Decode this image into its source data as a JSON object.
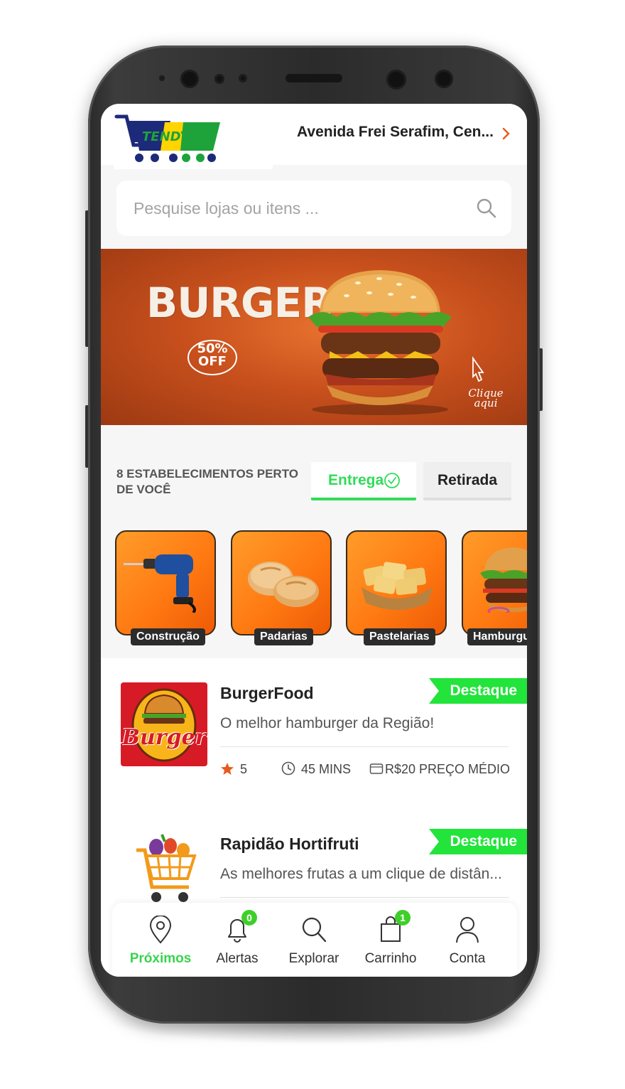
{
  "header": {
    "logo_text": "TENDYAAZ",
    "address": "Avenida Frei Serafim, Cen..."
  },
  "search": {
    "placeholder": "Pesquise lojas ou itens ..."
  },
  "banner": {
    "title": "BURGER",
    "discount_line1": "50%",
    "discount_line2": "OFF",
    "cta_line1": "Clique",
    "cta_line2": "aqui"
  },
  "filters": {
    "near_label": "8 ESTABELECIMENTOS PERTO DE VOCÊ",
    "delivery_tab": "Entrega",
    "pickup_tab": "Retirada",
    "selected": "Entrega"
  },
  "categories": [
    {
      "label": "Construção",
      "icon": "drill-icon"
    },
    {
      "label": "Padarias",
      "icon": "bread-icon"
    },
    {
      "label": "Pastelarias",
      "icon": "pastry-icon"
    },
    {
      "label": "Hamburgu",
      "icon": "burger-icon"
    }
  ],
  "stores": [
    {
      "name": "BurgerFood",
      "description": "O melhor hamburger da Região!",
      "badge": "Destaque",
      "rating": "5",
      "time": "45 MINS",
      "avg_price": "R$20 PREÇO MÉDIO",
      "logo_text": "Burger"
    },
    {
      "name": "Rapidão Hortifruti",
      "description": "As melhores frutas a um clique de distân...",
      "badge": "Destaque"
    }
  ],
  "nav": {
    "items": [
      {
        "label": "Próximos",
        "icon": "location-pin-icon",
        "active": true
      },
      {
        "label": "Alertas",
        "icon": "bell-icon",
        "badge": "0"
      },
      {
        "label": "Explorar",
        "icon": "search-icon"
      },
      {
        "label": "Carrinho",
        "icon": "shopping-bag-icon",
        "badge": "1"
      },
      {
        "label": "Conta",
        "icon": "user-icon"
      }
    ]
  },
  "colors": {
    "accent_green": "#2fdc58",
    "badge_green": "#22e43b",
    "category_orange": "#ff7a12",
    "star_orange": "#e85a1b"
  }
}
